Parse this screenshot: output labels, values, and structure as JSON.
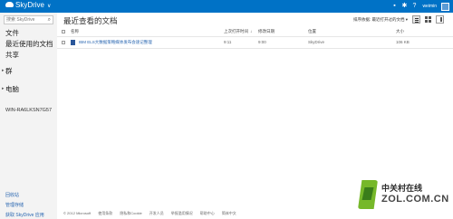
{
  "topbar": {
    "brand": "SkyDrive",
    "user": "weimin",
    "color": "#0072c6"
  },
  "sidebar": {
    "search_placeholder": "搜索 SkyDrive",
    "items": [
      {
        "label": "文件"
      },
      {
        "label": "最近使用的文档"
      },
      {
        "label": "共享"
      }
    ],
    "groups": [
      {
        "label": "群"
      },
      {
        "label": "电脑"
      }
    ],
    "pc_name": "WIN-RA6LKSN7G57",
    "footer_links": [
      "回收站",
      "管理存储",
      "获取 SkyDrive 应用"
    ]
  },
  "main": {
    "title": "最近查看的文档",
    "sort_label": "排序依据: 最近打开过的文档 ▾",
    "columns": {
      "name": "名称",
      "opened": "上次打开时间",
      "modified": "修改日期",
      "location": "位置",
      "size": "大小"
    },
    "rows": [
      {
        "name": "IBM ELS大数据策略媒体发布会速记整理",
        "opened": "9:11",
        "modified": "9:00",
        "location": "SkyDrive",
        "size": "106 KB"
      }
    ]
  },
  "footer": [
    "© 2012 Microsoft",
    "使用条款",
    "隐私和Cookie",
    "开发人员",
    "举报滥用情况",
    "帮助中心",
    "简体中文"
  ],
  "watermark": {
    "cn": "中关村在线",
    "en": "ZOL.COM.CN"
  }
}
